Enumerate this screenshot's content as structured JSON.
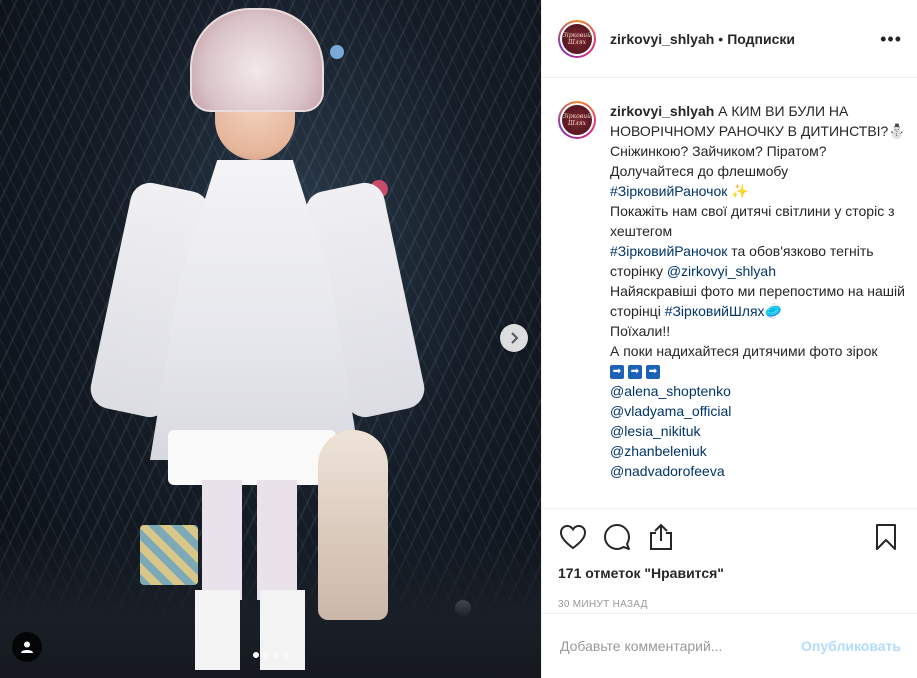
{
  "post": {
    "username": "zirkovyi_shlyah",
    "separator": "•",
    "follow_label": "Подписки",
    "more_label": "•••",
    "avatar_text": "Зірковий Шлях"
  },
  "caption": {
    "username": "zirkovyi_shlyah",
    "line1": "А КИМ ВИ БУЛИ НА НОВОРІЧНОМУ РАНОЧКУ В ДИТИНСТВІ?⛄",
    "line2": "Сніжинкою? Зайчиком? Піратом?",
    "line3": "Долучайтеся до флешмобу",
    "hashtag1": "#ЗірковийРаночок",
    "line3_emoji": "✨",
    "line4": "Покажіть нам свої дитячі світлини у сторіс з хештегом",
    "hashtag2": "#ЗірковийРаночок",
    "line5a": " та обов'язково тегніть сторінку ",
    "mention_page": "@zirkovyi_shlyah",
    "line6": "Найяскравіші фото ми перепостимо на нашій сторінці ",
    "hashtag3": "#ЗірковийШлях",
    "line6_emoji": "🥏",
    "line7": "Поїхали!!",
    "line8": "А поки надихайтеся дитячими фото зірок",
    "arrow_glyph": "➡",
    "mentions": [
      "@alena_shoptenko",
      "@vladyama_official",
      "@lesia_nikituk",
      "@zhanbeleniuk",
      "@nadvadorofeeva"
    ]
  },
  "actions": {
    "likes_text": "171 отметок \"Нравится\"",
    "time_text": "30 минут назад"
  },
  "comment": {
    "placeholder": "Добавьте комментарий...",
    "publish_label": "Опубликовать"
  },
  "colors": {
    "link": "#003569",
    "publish_disabled": "#b3dbff",
    "muted": "#999999"
  }
}
